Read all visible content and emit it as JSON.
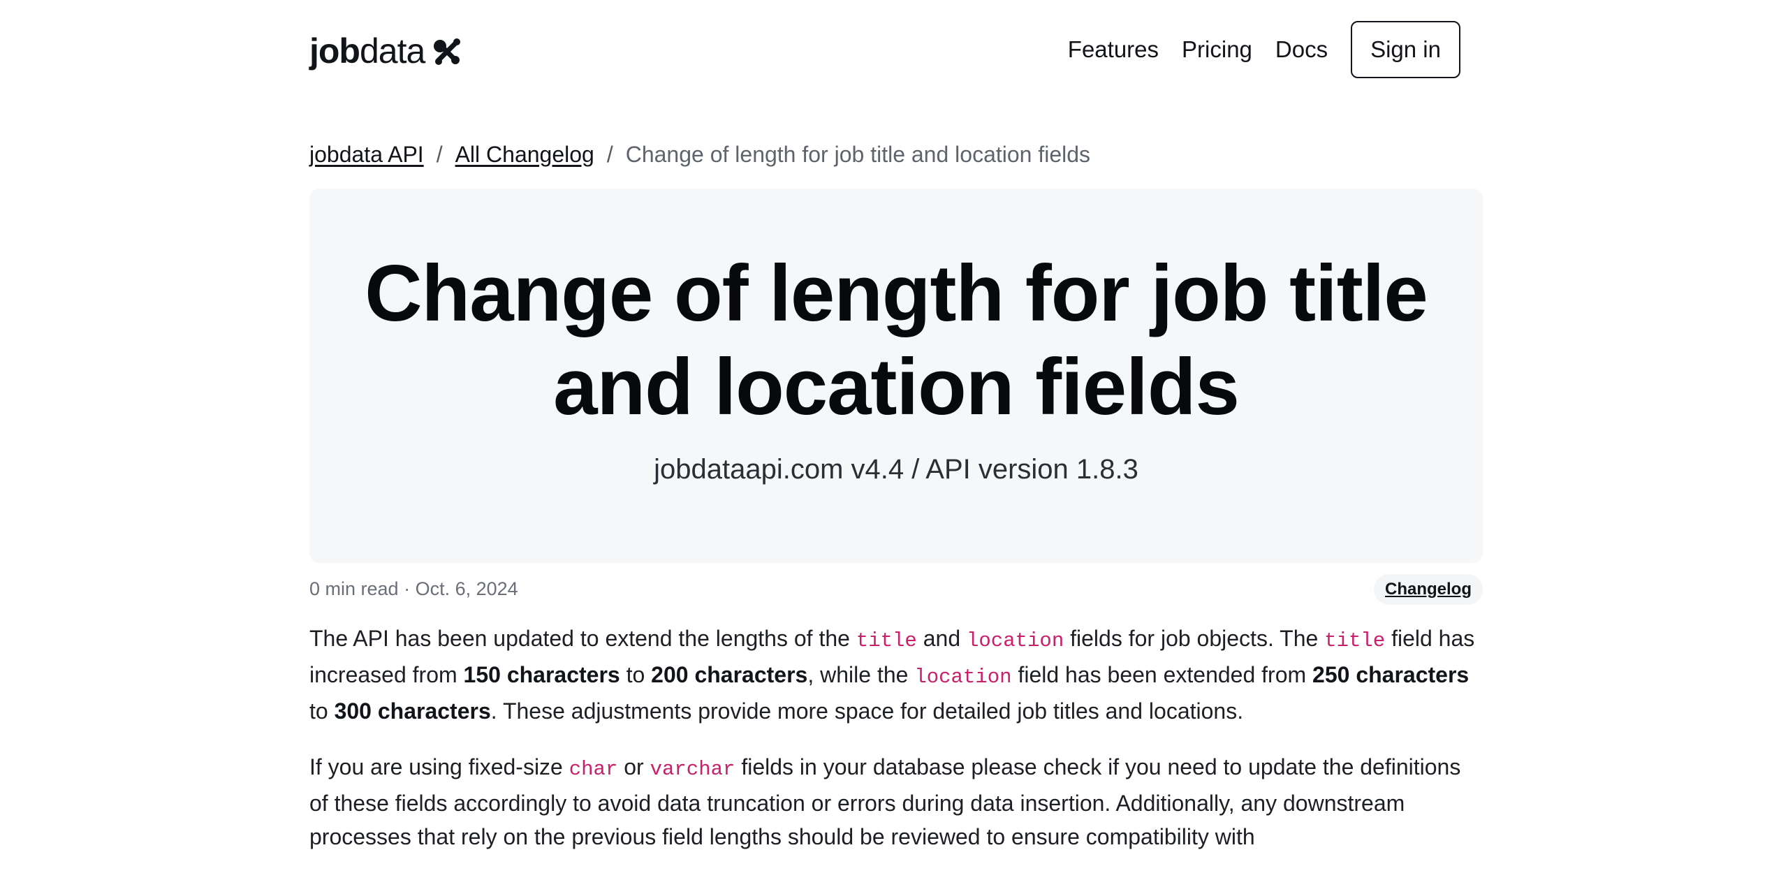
{
  "header": {
    "logo_bold": "job",
    "logo_light": "data",
    "nav": [
      "Features",
      "Pricing",
      "Docs"
    ],
    "signin_label": "Sign in"
  },
  "breadcrumb": {
    "items": [
      "jobdata API",
      "All Changelog"
    ],
    "separator": "/",
    "current": "Change of length for job title and location fields"
  },
  "hero": {
    "title_line1": "Change of length for job title",
    "title_line2": "and location fields",
    "subtitle": "jobdataapi.com v4.4 / API version 1.8.3"
  },
  "meta": {
    "read_time": "0 min read",
    "dot": "·",
    "date": "Oct. 6, 2024",
    "tag": "Changelog"
  },
  "content": {
    "p1": {
      "t1": "The API has been updated to extend the lengths of the ",
      "c1": "title",
      "t2": " and ",
      "c2": "location",
      "t3": " fields for job objects. The ",
      "c3": "title",
      "t4": " field has increased from ",
      "b1": "150 characters",
      "t5": " to ",
      "b2": "200 characters",
      "t6": ", while the ",
      "c4": "location",
      "t7": " field has been extended from ",
      "b3": "250 characters",
      "t8": " to ",
      "b4": "300 characters",
      "t9": ". These adjustments provide more space for detailed job titles and locations."
    },
    "p2": {
      "t1": "If you are using fixed-size ",
      "c1": "char",
      "t2": " or ",
      "c2": "varchar",
      "t3": " fields in your database please check if you need to update the definitions of these fields accordingly to avoid data truncation or errors during data insertion. Additionally, any downstream processes that rely on the previous field lengths should be reviewed to ensure compatibility with"
    }
  }
}
